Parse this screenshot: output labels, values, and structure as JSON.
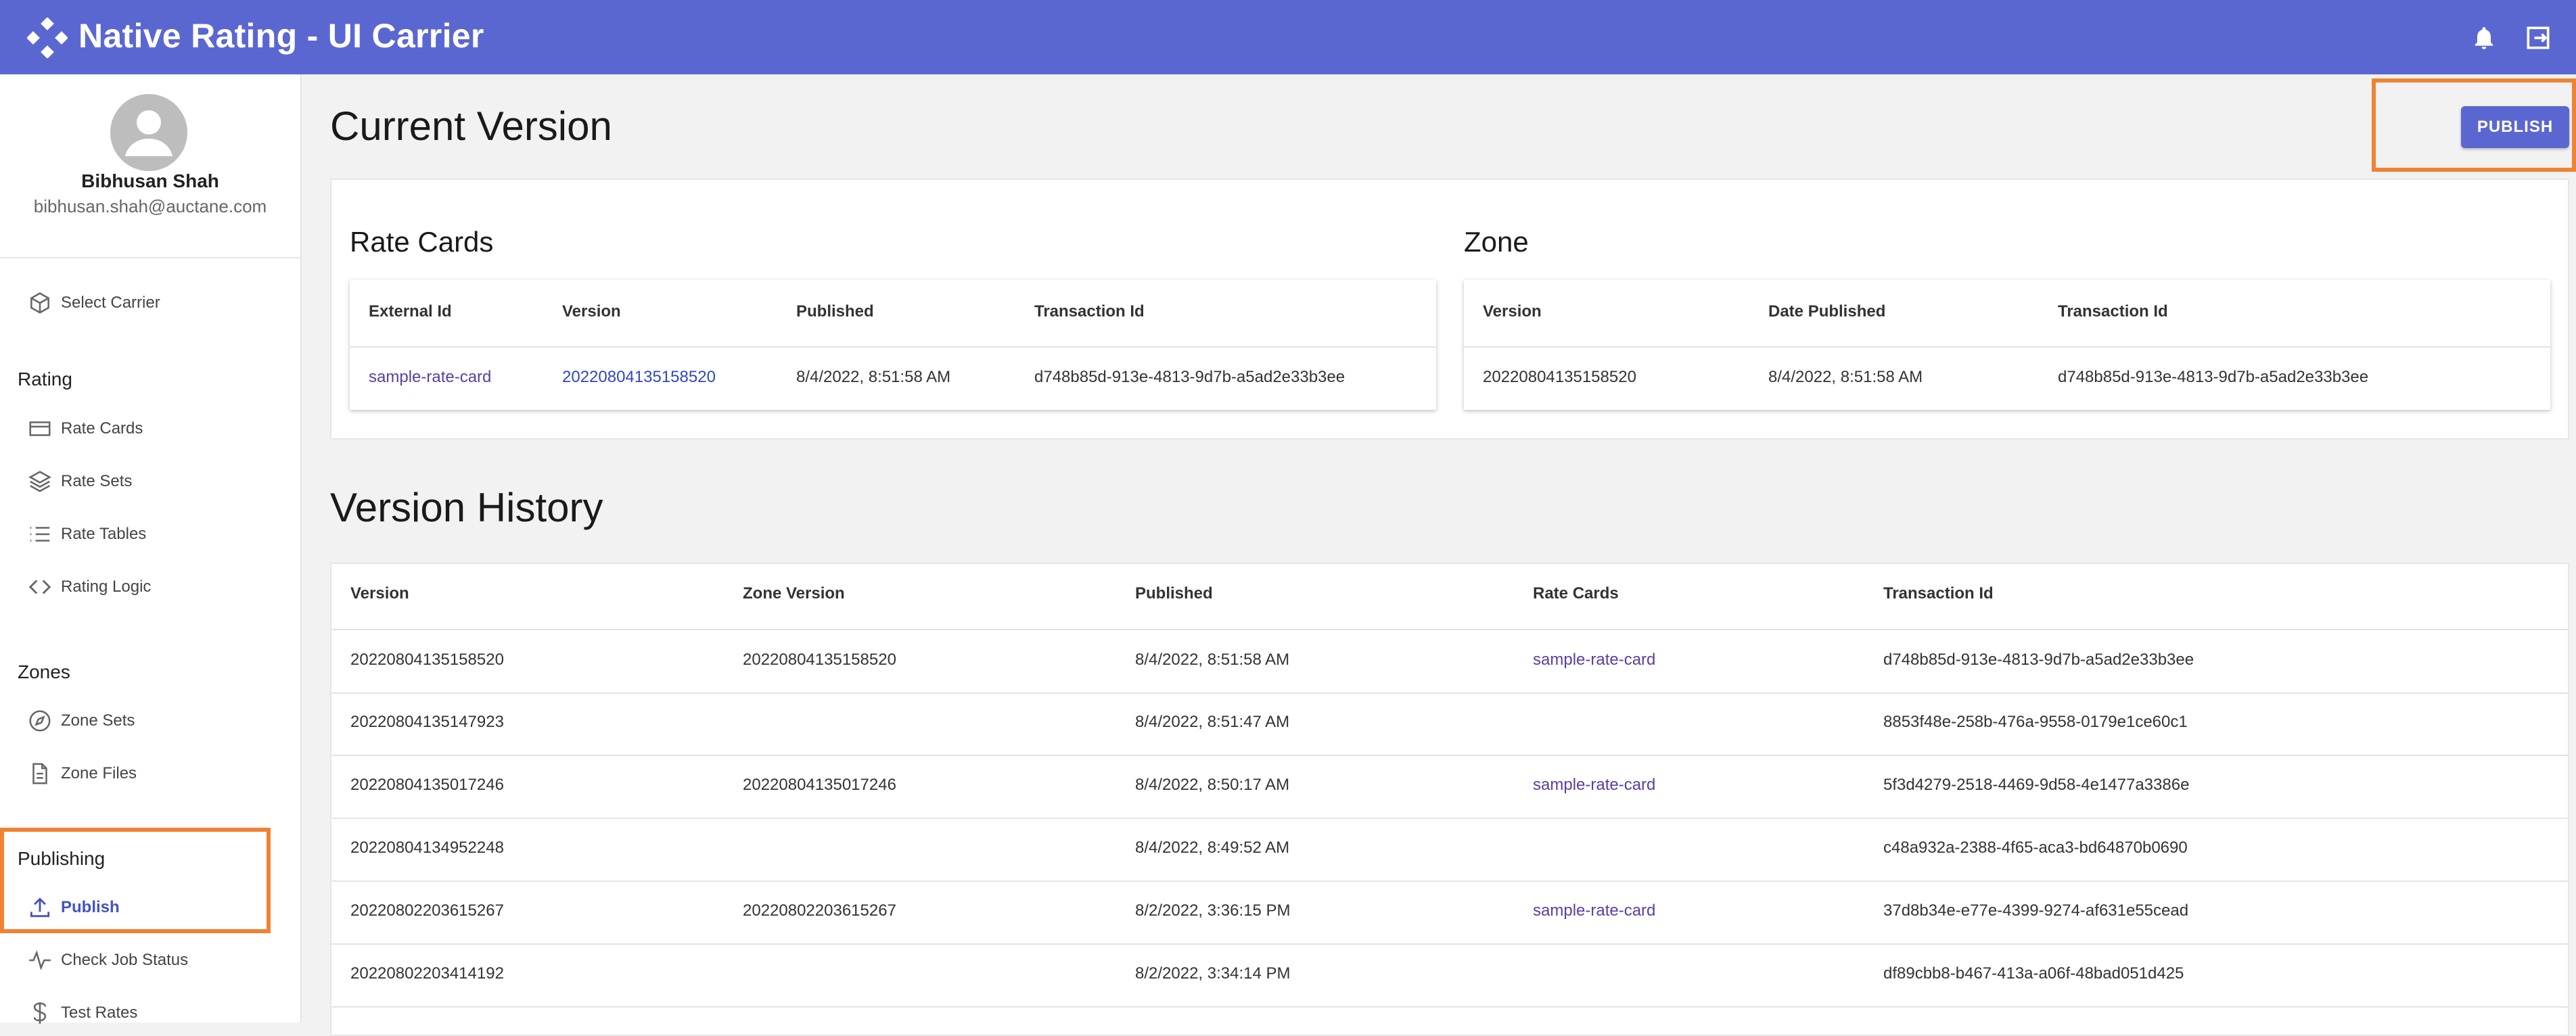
{
  "app": {
    "title": "Native Rating - UI Carrier"
  },
  "header": {
    "icons": [
      "app-logo-icon",
      "bell-icon",
      "logout-icon"
    ],
    "color": "#5b67d1"
  },
  "user": {
    "name": "Bibhusan Shah",
    "email": "bibhusan.shah@auctane.com"
  },
  "sidebar": {
    "select_carrier": "Select Carrier",
    "sections": {
      "rating": "Rating",
      "zones": "Zones",
      "publishing": "Publishing"
    },
    "items": {
      "rate_cards": "Rate Cards",
      "rate_sets": "Rate Sets",
      "rate_tables": "Rate Tables",
      "rating_logic": "Rating Logic",
      "zone_sets": "Zone Sets",
      "zone_files": "Zone Files",
      "publish": "Publish",
      "check_job_status": "Check Job Status",
      "test_rates": "Test Rates"
    }
  },
  "current_version": {
    "title": "Current Version",
    "publish_button": "PUBLISH",
    "rate_cards": {
      "title": "Rate Cards",
      "headers": [
        "External Id",
        "Version",
        "Published",
        "Transaction Id"
      ],
      "row": [
        "sample-rate-card",
        "20220804135158520",
        "8/4/2022, 8:51:58 AM",
        "d748b85d-913e-4813-9d7b-a5ad2e33b3ee"
      ]
    },
    "zone": {
      "title": "Zone",
      "headers": [
        "Version",
        "Date Published",
        "Transaction Id"
      ],
      "row": [
        "20220804135158520",
        "8/4/2022, 8:51:58 AM",
        "d748b85d-913e-4813-9d7b-a5ad2e33b3ee"
      ]
    }
  },
  "version_history": {
    "title": "Version History",
    "headers": [
      "Version",
      "Zone Version",
      "Published",
      "Rate Cards",
      "Transaction Id"
    ],
    "rows": [
      [
        "20220804135158520",
        "20220804135158520",
        "8/4/2022, 8:51:58 AM",
        "sample-rate-card",
        "d748b85d-913e-4813-9d7b-a5ad2e33b3ee"
      ],
      [
        "20220804135147923",
        "",
        "8/4/2022, 8:51:47 AM",
        "",
        "8853f48e-258b-476a-9558-0179e1ce60c1"
      ],
      [
        "20220804135017246",
        "20220804135017246",
        "8/4/2022, 8:50:17 AM",
        "sample-rate-card",
        "5f3d4279-2518-4469-9d58-4e1477a3386e"
      ],
      [
        "20220804134952248",
        "",
        "8/4/2022, 8:49:52 AM",
        "",
        "c48a932a-2388-4f65-aca3-bd64870b0690"
      ],
      [
        "20220802203615267",
        "20220802203615267",
        "8/2/2022, 3:36:15 PM",
        "sample-rate-card",
        "37d8b34e-e77e-4399-9274-af631e55cead"
      ],
      [
        "20220802203414192",
        "",
        "8/2/2022, 3:34:14 PM",
        "",
        "df89cbb8-b467-413a-a06f-48bad051d425"
      ]
    ]
  }
}
